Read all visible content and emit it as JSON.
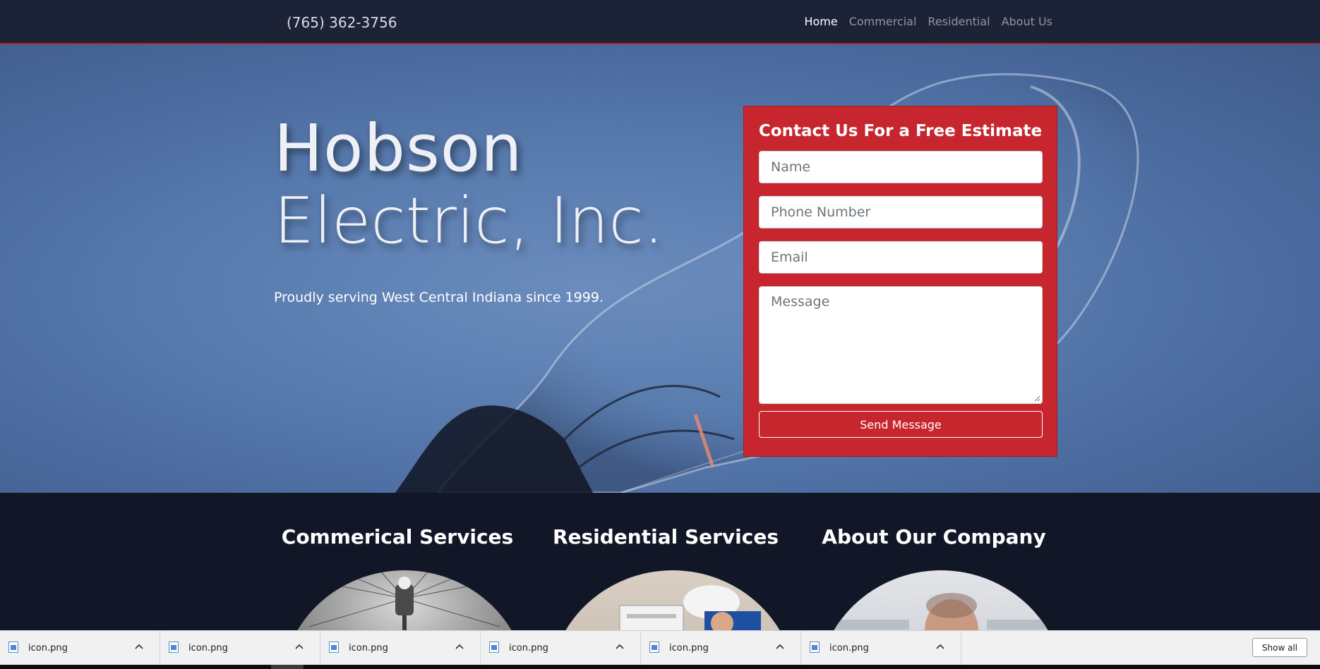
{
  "navbar": {
    "phone": "(765) 362-3756",
    "links": [
      {
        "label": "Home",
        "active": true
      },
      {
        "label": "Commercial",
        "active": false
      },
      {
        "label": "Residential",
        "active": false
      },
      {
        "label": "About Us",
        "active": false
      }
    ]
  },
  "hero": {
    "title_line1": "Hobson",
    "title_line2": "Electric, Inc.",
    "subtitle": "Proudly serving West Central Indiana since 1999."
  },
  "contact": {
    "heading": "Contact Us For a Free Estimate",
    "name_placeholder": "Name",
    "phone_placeholder": "Phone Number",
    "email_placeholder": "Email",
    "message_placeholder": "Message",
    "send_label": "Send Message"
  },
  "services": [
    {
      "title": "Commerical Services"
    },
    {
      "title": "Residential Services"
    },
    {
      "title": "About Our Company"
    }
  ],
  "downloads": {
    "items": [
      "icon.png",
      "icon.png",
      "icon.png",
      "icon.png",
      "icon.png",
      "icon.png"
    ],
    "show_all": "Show all"
  },
  "colors": {
    "navbar_bg": "#1d2337",
    "accent_red": "#c8262e",
    "hero_blue": "#5a7db0",
    "services_bg": "#121728"
  }
}
